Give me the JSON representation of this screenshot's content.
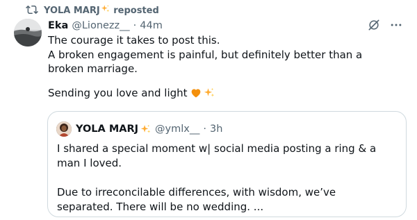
{
  "repost": {
    "user": "YOLA MARJ",
    "label": "reposted"
  },
  "tweet": {
    "author_name": "Eka",
    "handle": "@Lionezz__",
    "separator": "·",
    "time": "44m",
    "text": "The courage it takes to post this.\nA broken engagement is painful, but definitely better than a broken marriage.",
    "closing": "Sending you love and light "
  },
  "quote": {
    "author_name": "YOLA MARJ",
    "handle": "@ymlx__",
    "separator": "·",
    "time": "3h",
    "text": "I shared a special moment w| social media posting a ring & a man I loved.\n\nDue to irreconcilable differences, with wisdom, we’ve separated. There will be no wedding. ..."
  },
  "icons": {
    "repost": "repost-icon",
    "grok": "grok-icon",
    "more": "more-icon",
    "heart": "orange-heart-icon",
    "sparkles": "sparkles-icon"
  },
  "colors": {
    "text": "#0f1419",
    "secondary": "#536471",
    "border": "#cfd9de",
    "heart": "#f4900c",
    "sparkle": "#ffac33"
  }
}
